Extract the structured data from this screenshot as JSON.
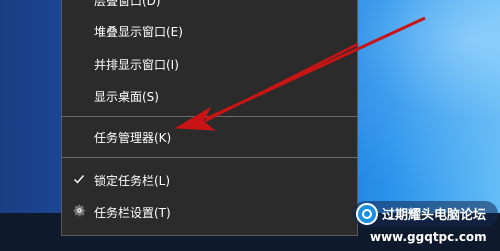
{
  "context_menu": {
    "items": [
      {
        "label": "层叠窗口(D)"
      },
      {
        "label": "堆叠显示窗口(E)"
      },
      {
        "label": "并排显示窗口(I)"
      },
      {
        "label": "显示桌面(S)"
      },
      {
        "label": "任务管理器(K)"
      },
      {
        "label": "锁定任务栏(L)",
        "checked": true,
        "icon": "checkmark-icon"
      },
      {
        "label": "任务栏设置(T)",
        "icon": "gear-icon"
      }
    ]
  },
  "annotation": {
    "color": "#c81414"
  },
  "watermark": {
    "title": "过期耀头电脑论坛",
    "url": "www.ggqtpc.com"
  }
}
